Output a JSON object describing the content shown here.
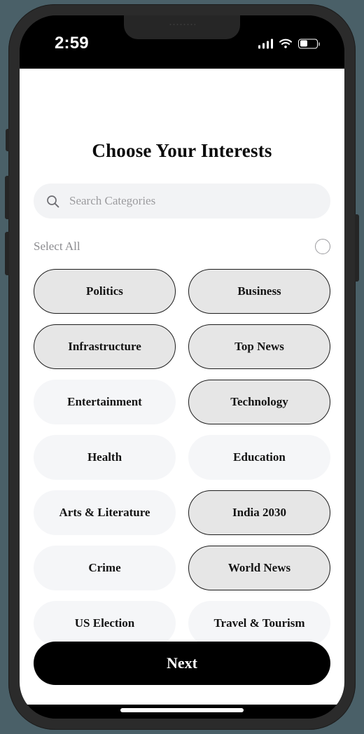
{
  "status_bar": {
    "time": "2:59",
    "cellular_icon": "signal-bars-icon",
    "wifi_icon": "wifi-icon",
    "battery_icon": "battery-icon",
    "battery_level_percent": 45
  },
  "header": {
    "title": "Choose Your Interests"
  },
  "search": {
    "icon": "search-icon",
    "placeholder": "Search Categories",
    "value": ""
  },
  "select_all": {
    "label": "Select All",
    "checked": false,
    "checkbox_icon": "circle-unchecked-icon"
  },
  "categories": [
    {
      "label": "Politics",
      "selected": true
    },
    {
      "label": "Business",
      "selected": true
    },
    {
      "label": "Infrastructure",
      "selected": true
    },
    {
      "label": "Top News",
      "selected": true
    },
    {
      "label": "Entertainment",
      "selected": false
    },
    {
      "label": "Technology",
      "selected": true
    },
    {
      "label": "Health",
      "selected": false
    },
    {
      "label": "Education",
      "selected": false
    },
    {
      "label": "Arts & Literature",
      "selected": false
    },
    {
      "label": "India 2030",
      "selected": true
    },
    {
      "label": "Crime",
      "selected": false
    },
    {
      "label": "World News",
      "selected": true
    },
    {
      "label": "US Election",
      "selected": false
    },
    {
      "label": "Travel & Tourism",
      "selected": false
    }
  ],
  "footer": {
    "next_label": "Next"
  },
  "colors": {
    "background": "#4a6068",
    "frame": "#2b2b2b",
    "screen_bg": "#ffffff",
    "chip_unselected_bg": "#f5f6f8",
    "chip_selected_bg": "#e6e6e6",
    "chip_selected_border": "#1d1d1d",
    "search_bg": "#f2f3f5",
    "primary_button_bg": "#000000"
  }
}
